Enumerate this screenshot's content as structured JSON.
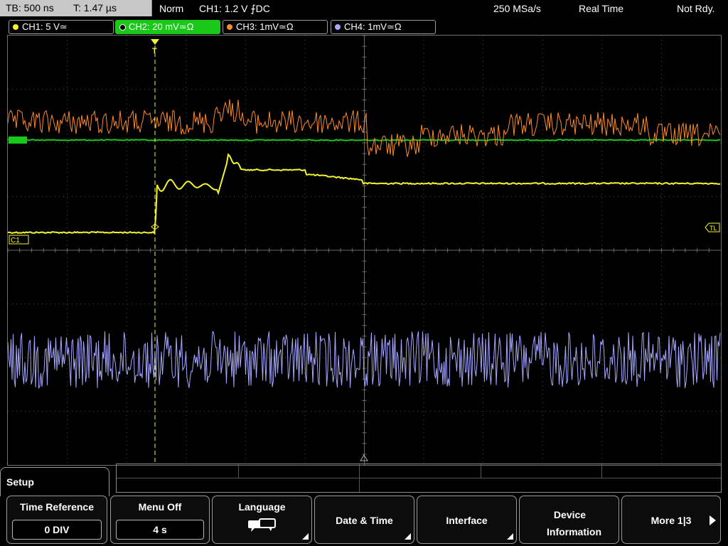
{
  "status_bar": {
    "timebase": "TB: 500 ns",
    "trigger_time": "T: 1.47 µs",
    "trigger_mode": "Norm",
    "trigger_setting": "CH1: 1.2 V ⨍DC",
    "sample_rate": "250 MSa/s",
    "acq_mode": "Real Time",
    "run_state": "Not Rdy."
  },
  "channels": [
    {
      "label": "CH1: 5 V≃",
      "color": "#f5f52d",
      "active": false
    },
    {
      "label": "CH2: 20 mV≃Ω",
      "color": "#19c819",
      "active": true
    },
    {
      "label": "CH3: 1mV≃Ω",
      "color": "#ff8a2a",
      "active": false
    },
    {
      "label": "CH4: 1mV≃Ω",
      "color": "#a7a7ff",
      "active": false
    }
  ],
  "screen": {
    "ch1_marker": "C1",
    "trigger_level_marker": "TL",
    "trigger_pos_marker": "T",
    "colors": {
      "grid": "#4a4a4a",
      "ch1": "#f5f52d",
      "ch2": "#19c819",
      "ch3": "#ff8a2a",
      "ch4": "#a7a7ff"
    }
  },
  "menu": {
    "title": "Setup",
    "softkeys": [
      {
        "title": "Time Reference",
        "value": "0 DIV"
      },
      {
        "title": "Menu Off",
        "value": "4 s"
      },
      {
        "title": "Language",
        "icon": "speech-bubble-icon"
      },
      {
        "title": "Date & Time"
      },
      {
        "title": "Interface"
      },
      {
        "title": "Device Information"
      },
      {
        "title": "More 1|3"
      }
    ]
  }
}
